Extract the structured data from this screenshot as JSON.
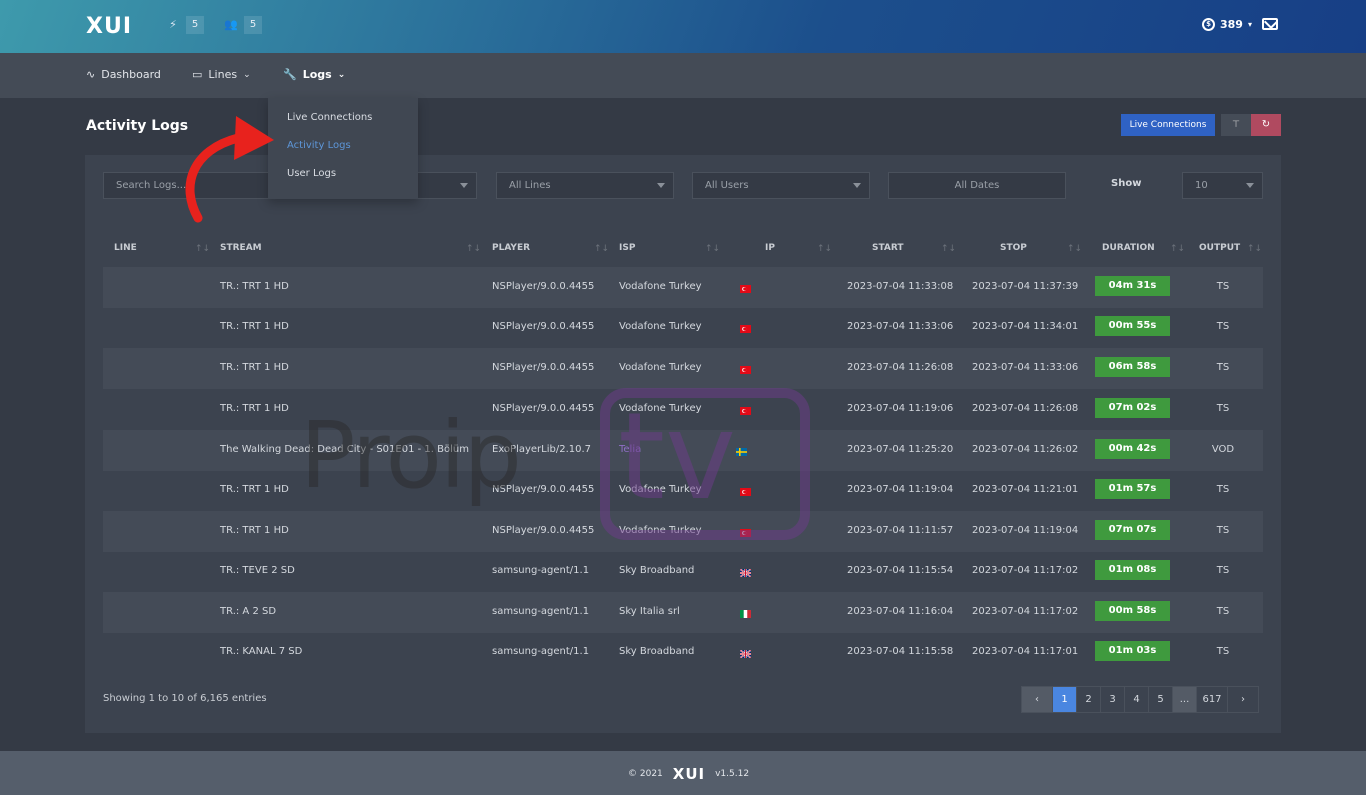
{
  "header": {
    "logo": "XUI",
    "badges": [
      {
        "icon": "bolt-icon",
        "count": "5"
      },
      {
        "icon": "users-icon",
        "count": "5"
      }
    ],
    "credits": "389"
  },
  "nav": {
    "dashboard": "Dashboard",
    "lines": "Lines",
    "logs": "Logs"
  },
  "dropdown": [
    "Live Connections",
    "Activity Logs",
    "User Logs"
  ],
  "page": {
    "title": "Activity Logs",
    "live_button": "Live Connections"
  },
  "filters": {
    "search_placeholder": "Search Logs...",
    "lines": "All Lines",
    "users": "All Users",
    "dates": "All Dates",
    "show_label": "Show",
    "show_value": "10"
  },
  "columns": [
    "LINE",
    "STREAM",
    "PLAYER",
    "ISP",
    "IP",
    "START",
    "STOP",
    "DURATION",
    "OUTPUT"
  ],
  "rows": [
    {
      "stream": "TR.: TRT 1 HD",
      "player": "NSPlayer/9.0.0.4455",
      "isp": "Vodafone Turkey",
      "flag": "tr",
      "start": "2023-07-04 11:33:08",
      "stop": "2023-07-04 11:37:39",
      "duration": "04m 31s",
      "output": "TS"
    },
    {
      "stream": "TR.: TRT 1 HD",
      "player": "NSPlayer/9.0.0.4455",
      "isp": "Vodafone Turkey",
      "flag": "tr",
      "start": "2023-07-04 11:33:06",
      "stop": "2023-07-04 11:34:01",
      "duration": "00m 55s",
      "output": "TS"
    },
    {
      "stream": "TR.: TRT 1 HD",
      "player": "NSPlayer/9.0.0.4455",
      "isp": "Vodafone Turkey",
      "flag": "tr",
      "start": "2023-07-04 11:26:08",
      "stop": "2023-07-04 11:33:06",
      "duration": "06m 58s",
      "output": "TS"
    },
    {
      "stream": "TR.: TRT 1 HD",
      "player": "NSPlayer/9.0.0.4455",
      "isp": "Vodafone Turkey",
      "flag": "tr",
      "start": "2023-07-04 11:19:06",
      "stop": "2023-07-04 11:26:08",
      "duration": "07m 02s",
      "output": "TS"
    },
    {
      "stream": "The Walking Dead: Dead City - S01E01 - 1. Bölüm",
      "player": "ExoPlayerLib/2.10.7",
      "isp": "Telia",
      "flag": "se",
      "start": "2023-07-04 11:25:20",
      "stop": "2023-07-04 11:26:02",
      "duration": "00m 42s",
      "output": "VOD"
    },
    {
      "stream": "TR.: TRT 1 HD",
      "player": "NSPlayer/9.0.0.4455",
      "isp": "Vodafone Turkey",
      "flag": "tr",
      "start": "2023-07-04 11:19:04",
      "stop": "2023-07-04 11:21:01",
      "duration": "01m 57s",
      "output": "TS"
    },
    {
      "stream": "TR.: TRT 1 HD",
      "player": "NSPlayer/9.0.0.4455",
      "isp": "Vodafone Turkey",
      "flag": "tr",
      "start": "2023-07-04 11:11:57",
      "stop": "2023-07-04 11:19:04",
      "duration": "07m 07s",
      "output": "TS"
    },
    {
      "stream": "TR.: TEVE 2 SD",
      "player": "samsung-agent/1.1",
      "isp": "Sky Broadband",
      "flag": "gb",
      "start": "2023-07-04 11:15:54",
      "stop": "2023-07-04 11:17:02",
      "duration": "01m 08s",
      "output": "TS"
    },
    {
      "stream": "TR.: A 2 SD",
      "player": "samsung-agent/1.1",
      "isp": "Sky Italia srl",
      "flag": "it",
      "start": "2023-07-04 11:16:04",
      "stop": "2023-07-04 11:17:02",
      "duration": "00m 58s",
      "output": "TS"
    },
    {
      "stream": "TR.: KANAL 7 SD",
      "player": "samsung-agent/1.1",
      "isp": "Sky Broadband",
      "flag": "gb",
      "start": "2023-07-04 11:15:58",
      "stop": "2023-07-04 11:17:01",
      "duration": "01m 03s",
      "output": "TS"
    }
  ],
  "showing": "Showing 1 to 10 of 6,165 entries",
  "pagination": [
    "‹",
    "1",
    "2",
    "3",
    "4",
    "5",
    "...",
    "617",
    "›"
  ],
  "footer": {
    "copyright": "© 2021",
    "logo": "XUI",
    "version": "v1.5.12"
  },
  "watermark": {
    "text": "Proip",
    "box": "tv"
  },
  "colors": {
    "accent": "#2f62c4",
    "duration": "#3f9a3e",
    "danger": "#b04a60",
    "active_link": "#5d96d8"
  }
}
